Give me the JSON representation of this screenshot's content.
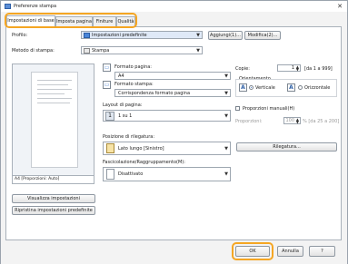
{
  "window": {
    "title": "Preferenze stampa"
  },
  "tabs": [
    {
      "label": "Impostazioni di base",
      "active": true
    },
    {
      "label": "Imposta pagina",
      "active": false
    },
    {
      "label": "Finiture",
      "active": false
    },
    {
      "label": "Qualità",
      "active": false
    }
  ],
  "profile": {
    "label": "Profilo:",
    "value": "Impostazioni predefinite",
    "add_button": "Aggiungi(1)...",
    "edit_button": "Modifica(2)..."
  },
  "print_method": {
    "label": "Metodo di stampa:",
    "value": "Stampa"
  },
  "preview": {
    "caption": "A4 [Proporzioni: Auto]"
  },
  "buttons": {
    "view_settings": "Visualizza impostazioni",
    "restore_defaults": "Ripristina impostazioni predefinite",
    "ok": "OK",
    "cancel": "Annulla",
    "help": "?"
  },
  "page_size": {
    "label": "Formato pagina:",
    "value": "A4"
  },
  "output_size": {
    "label": "Formato stampa:",
    "value": "Corrispondenza formato pagina"
  },
  "copies": {
    "label": "Copie:",
    "value": "1",
    "range": "[da 1 a 999]"
  },
  "orientation": {
    "label": "Orientamento",
    "portrait": "Verticale",
    "landscape": "Orizzontale",
    "selected": "portrait"
  },
  "page_layout": {
    "label": "Layout di pagina:",
    "value": "1 su 1",
    "icon_number": "1"
  },
  "manual_scaling": {
    "label": "Proporzioni manuali(H)",
    "checked": false,
    "scale_label": "Proporzioni:",
    "scale_value": "100",
    "scale_range": "% [da 25 a 200]"
  },
  "binding": {
    "label": "Posizione di rilegatura:",
    "value": "Lato lungo [Sinistro]",
    "button": "Rilegatura..."
  },
  "finishing": {
    "label": "Fascicolazione/Raggruppamento(M):",
    "value": "Disattivato"
  },
  "colors": {
    "accent_highlight": "#f5a623",
    "selected_blue": "#2b66c3"
  }
}
